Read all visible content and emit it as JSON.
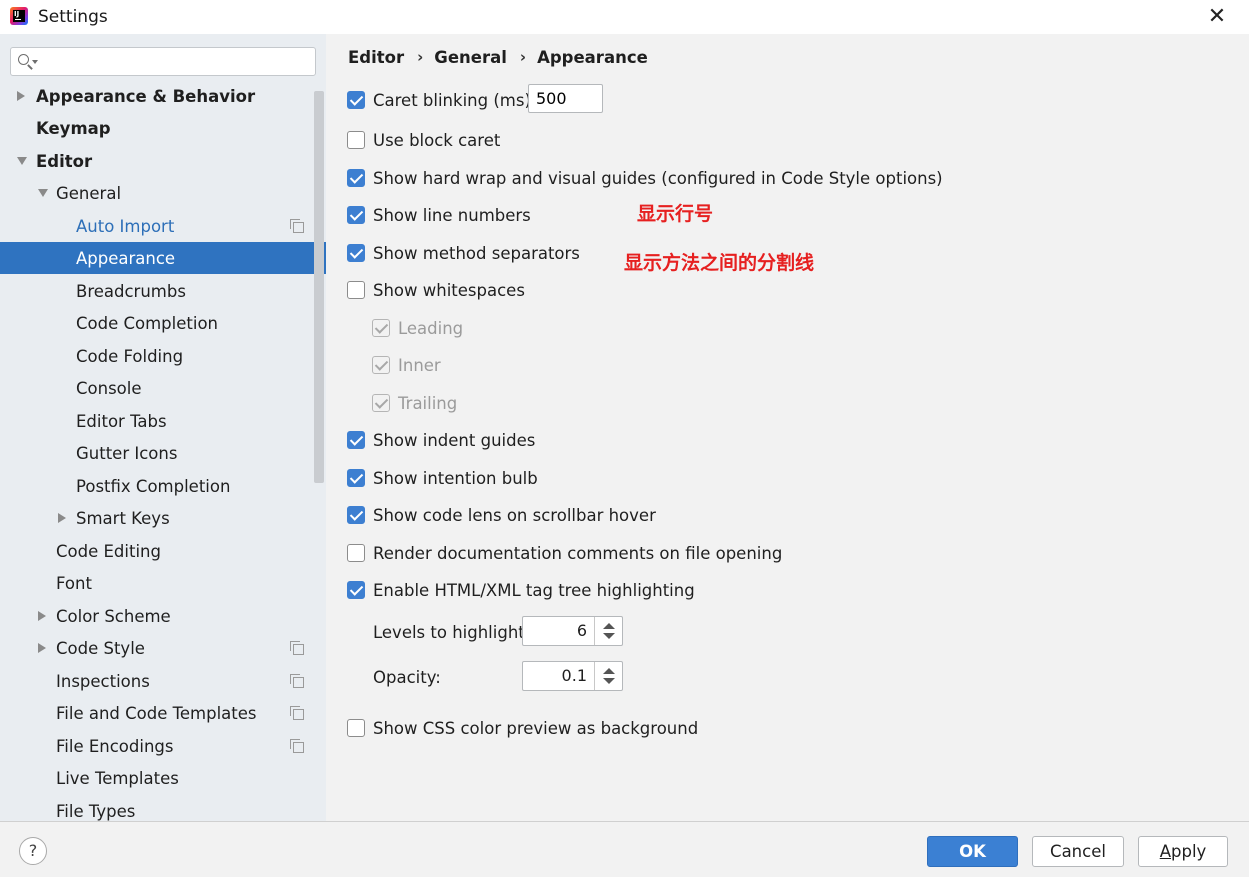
{
  "window": {
    "title": "Settings"
  },
  "search": {
    "placeholder": ""
  },
  "sidebar": {
    "items": [
      {
        "label": "Appearance & Behavior"
      },
      {
        "label": "Keymap"
      },
      {
        "label": "Editor"
      },
      {
        "label": "General"
      },
      {
        "label": "Auto Import"
      },
      {
        "label": "Appearance"
      },
      {
        "label": "Breadcrumbs"
      },
      {
        "label": "Code Completion"
      },
      {
        "label": "Code Folding"
      },
      {
        "label": "Console"
      },
      {
        "label": "Editor Tabs"
      },
      {
        "label": "Gutter Icons"
      },
      {
        "label": "Postfix Completion"
      },
      {
        "label": "Smart Keys"
      },
      {
        "label": "Code Editing"
      },
      {
        "label": "Font"
      },
      {
        "label": "Color Scheme"
      },
      {
        "label": "Code Style"
      },
      {
        "label": "Inspections"
      },
      {
        "label": "File and Code Templates"
      },
      {
        "label": "File Encodings"
      },
      {
        "label": "Live Templates"
      },
      {
        "label": "File Types"
      }
    ]
  },
  "breadcrumb": [
    "Editor",
    "General",
    "Appearance"
  ],
  "options": {
    "caret_blinking": {
      "label": "Caret blinking (ms):",
      "checked": true,
      "value": "500"
    },
    "use_block_caret": {
      "label": "Use block caret",
      "checked": false
    },
    "hard_wrap": {
      "label": "Show hard wrap and visual guides (configured in Code Style options)",
      "checked": true
    },
    "line_numbers": {
      "label": "Show line numbers",
      "checked": true
    },
    "method_separators": {
      "label": "Show method separators",
      "checked": true
    },
    "whitespaces": {
      "label": "Show whitespaces",
      "checked": false
    },
    "leading": {
      "label": "Leading",
      "checked": true,
      "disabled": true
    },
    "inner": {
      "label": "Inner",
      "checked": true,
      "disabled": true
    },
    "trailing": {
      "label": "Trailing",
      "checked": true,
      "disabled": true
    },
    "indent_guides": {
      "label": "Show indent guides",
      "checked": true
    },
    "intention_bulb": {
      "label": "Show intention bulb",
      "checked": true
    },
    "code_lens": {
      "label": "Show code lens on scrollbar hover",
      "checked": true
    },
    "render_docs": {
      "label": "Render documentation comments on file opening",
      "checked": false
    },
    "tag_tree": {
      "label": "Enable HTML/XML tag tree highlighting",
      "checked": true
    },
    "levels": {
      "label": "Levels to highlight:",
      "value": "6"
    },
    "opacity": {
      "label": "Opacity:",
      "value": "0.1"
    },
    "css_color": {
      "label": "Show CSS color preview as background",
      "checked": false
    }
  },
  "annotations": {
    "line_numbers_note": "显示行号",
    "method_separators_note": "显示方法之间的分割线"
  },
  "footer": {
    "help": "?",
    "ok": "OK",
    "cancel": "Cancel",
    "apply_mnemonic": "A",
    "apply_rest": "pply"
  },
  "colors": {
    "accent": "#3b80d3",
    "selection": "#2f73c0",
    "annotation": "#e62020",
    "sidebar_bg": "#e9edf1"
  }
}
